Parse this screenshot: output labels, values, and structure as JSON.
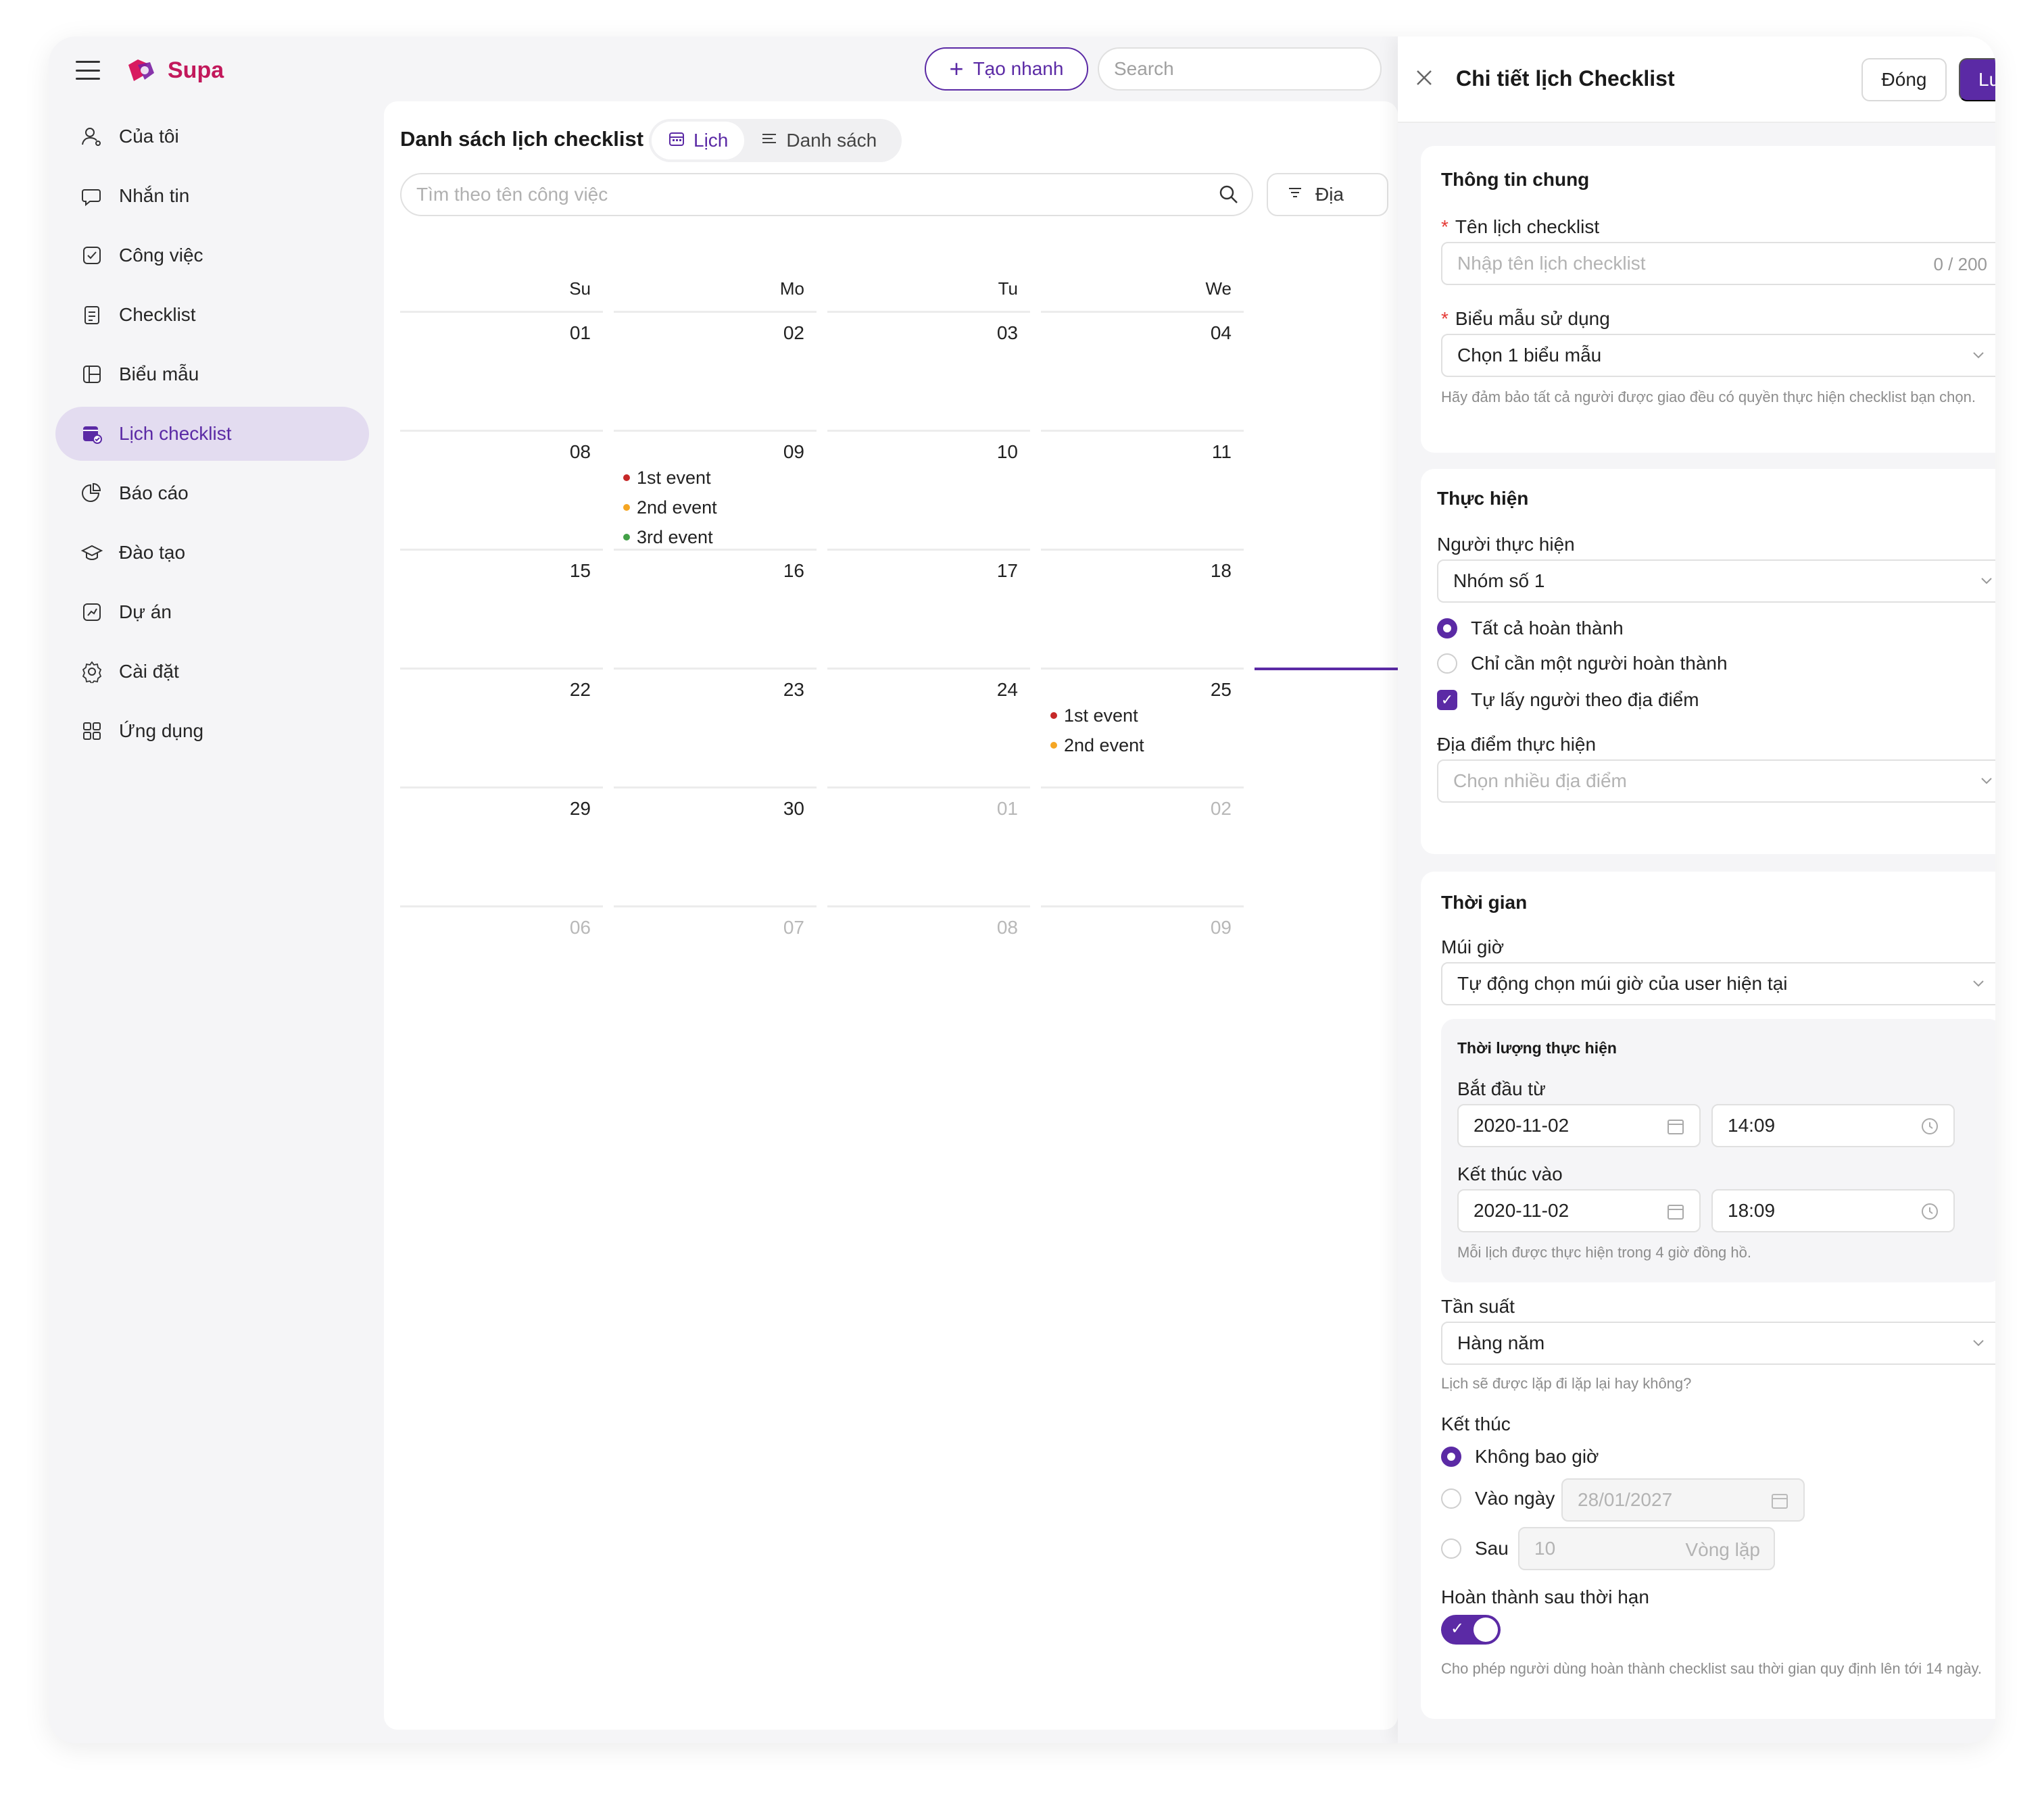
{
  "app": {
    "name": "Supa"
  },
  "header": {
    "quick_create_label": "Tạo nhanh",
    "search_placeholder": "Search"
  },
  "sidebar": {
    "items": [
      {
        "label": "Của tôi",
        "icon": "user-icon"
      },
      {
        "label": "Nhắn tin",
        "icon": "chat-icon"
      },
      {
        "label": "Công việc",
        "icon": "task-icon"
      },
      {
        "label": "Checklist",
        "icon": "checklist-icon"
      },
      {
        "label": "Biểu mẫu",
        "icon": "form-icon"
      },
      {
        "label": "Lịch checklist",
        "icon": "calendar-checklist-icon",
        "active": true
      },
      {
        "label": "Báo cáo",
        "icon": "report-icon"
      },
      {
        "label": "Đào tạo",
        "icon": "training-icon"
      },
      {
        "label": "Dự án",
        "icon": "project-icon"
      },
      {
        "label": "Cài đặt",
        "icon": "settings-icon"
      },
      {
        "label": "Ứng dụng",
        "icon": "apps-icon"
      }
    ]
  },
  "main": {
    "title": "Danh sách lịch checklist",
    "tabs": [
      {
        "label": "Lịch",
        "icon": "calendar-icon",
        "active": true
      },
      {
        "label": "Danh sách",
        "icon": "list-icon",
        "active": false
      }
    ],
    "task_search_placeholder": "Tìm theo tên công việc",
    "filter_label": "Địa"
  },
  "calendar": {
    "weekdays": [
      "Su",
      "Mo",
      "Tu",
      "We"
    ],
    "weeks": [
      [
        {
          "day": "01"
        },
        {
          "day": "02"
        },
        {
          "day": "03"
        },
        {
          "day": "04"
        }
      ],
      [
        {
          "day": "08"
        },
        {
          "day": "09",
          "events": [
            {
              "label": "1st event",
              "color": "#c62828"
            },
            {
              "label": "2nd event",
              "color": "#f5a623"
            },
            {
              "label": "3rd event",
              "color": "#43a047"
            }
          ]
        },
        {
          "day": "10"
        },
        {
          "day": "11"
        }
      ],
      [
        {
          "day": "15"
        },
        {
          "day": "16"
        },
        {
          "day": "17"
        },
        {
          "day": "18"
        }
      ],
      [
        {
          "day": "22"
        },
        {
          "day": "23"
        },
        {
          "day": "24"
        },
        {
          "day": "25",
          "events": [
            {
              "label": "1st event",
              "color": "#c62828"
            },
            {
              "label": "2nd event",
              "color": "#f5a623"
            }
          ]
        }
      ],
      [
        {
          "day": "29"
        },
        {
          "day": "30"
        },
        {
          "day": "01",
          "muted": true
        },
        {
          "day": "02",
          "muted": true
        }
      ],
      [
        {
          "day": "06",
          "muted": true
        },
        {
          "day": "07",
          "muted": true
        },
        {
          "day": "08",
          "muted": true
        },
        {
          "day": "09",
          "muted": true
        }
      ]
    ]
  },
  "drawer": {
    "title": "Chi tiết lịch Checklist",
    "close_label": "Đóng",
    "save_label": "Lưu",
    "general": {
      "title": "Thông tin chung",
      "name_label": "Tên lịch checklist",
      "name_placeholder": "Nhập tên lịch checklist",
      "name_counter": "0 / 200",
      "template_label": "Biểu mẫu sử dụng",
      "template_value": "Chọn 1 biểu mẫu",
      "template_hint": "Hãy đảm bảo tất cả người được giao đều có quyền thực hiện checklist bạn chọn."
    },
    "execution": {
      "title": "Thực hiện",
      "assignee_label": "Người thực hiện",
      "assignee_value": "Nhóm số 1",
      "option_all": "Tất cả hoàn thành",
      "option_one": "Chỉ cần một người hoàn thành",
      "auto_assign": "Tự lấy người theo địa điểm",
      "location_label": "Địa điểm thực hiện",
      "location_placeholder": "Chọn nhiều địa điểm"
    },
    "time": {
      "title": "Thời gian",
      "timezone_label": "Múi giờ",
      "timezone_value": "Tự động chọn múi giờ của user hiện tại",
      "duration_title": "Thời lượng thực hiện",
      "start_label": "Bắt đầu từ",
      "start_date": "2020-11-02",
      "start_time": "14:09",
      "end_label": "Kết thúc vào",
      "end_date": "2020-11-02",
      "end_time": "18:09",
      "duration_hint": "Mỗi lịch được thực hiện trong 4 giờ đồng hồ.",
      "frequency_label": "Tần suất",
      "frequency_value": "Hàng năm",
      "frequency_hint": "Lịch sẽ được lặp đi lặp lại hay không?",
      "end_label_2": "Kết thúc",
      "end_never": "Không bao giờ",
      "end_on_date": "Vào ngày",
      "end_on_date_value": "28/01/2027",
      "end_after": "Sau",
      "end_after_value": "10",
      "end_after_unit": "Vòng lặp",
      "late_label": "Hoàn thành sau thời hạn",
      "late_enabled": true,
      "late_hint": "Cho phép người dùng hoàn thành checklist sau thời gian quy định lên tới 14 ngày."
    }
  },
  "colors": {
    "accent": "#5b2aa5",
    "accent_light": "#e3dcf0",
    "brand": "#c2185b"
  }
}
